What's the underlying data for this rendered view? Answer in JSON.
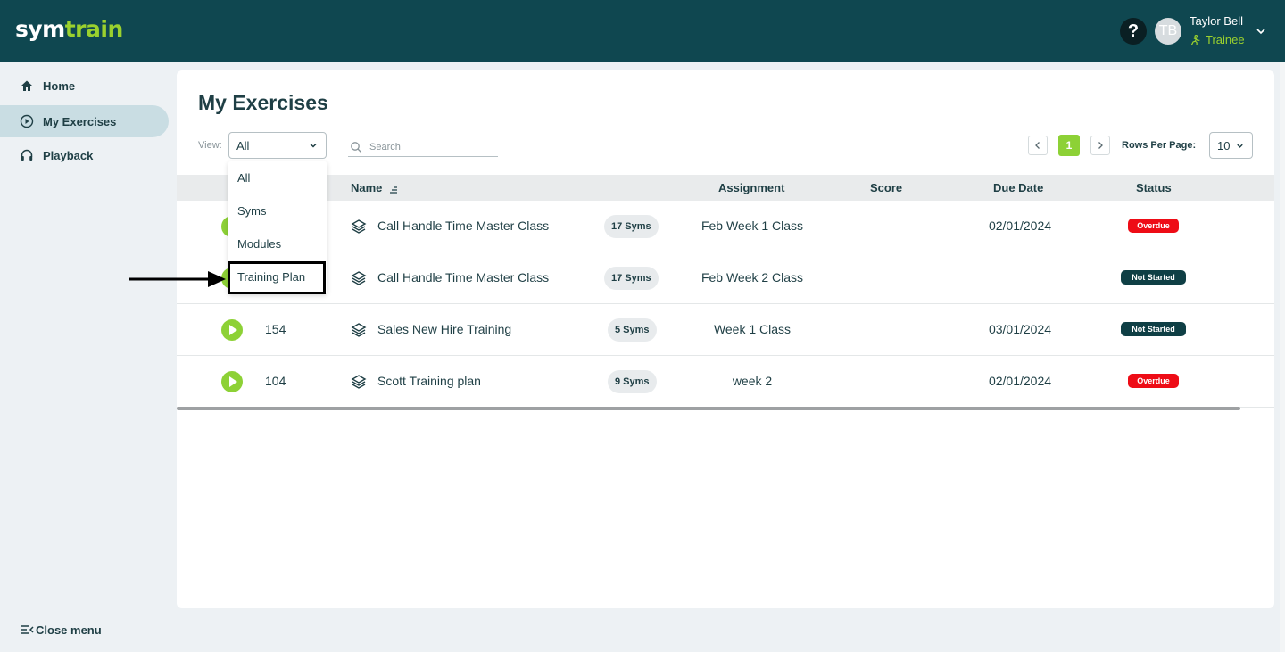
{
  "header": {
    "logo_sym": "sym",
    "logo_train": "train",
    "help": "?",
    "avatar_initials": "TB",
    "user_name": "Taylor Bell",
    "user_role": "Trainee"
  },
  "sidebar": {
    "items": [
      {
        "label": "Home",
        "icon": "home-icon"
      },
      {
        "label": "My Exercises",
        "icon": "play-circle-icon",
        "active": true
      },
      {
        "label": "Playback",
        "icon": "headphones-icon"
      }
    ],
    "close_menu": "Close menu"
  },
  "main": {
    "title": "My Exercises",
    "view_label": "View:",
    "view_value": "All",
    "search_placeholder": "Search",
    "current_page": "1",
    "rows_per_page_label": "Rows Per Page:",
    "rows_per_page_value": "10",
    "columns": [
      "Name",
      "Assignment",
      "Score",
      "Due Date",
      "Status"
    ],
    "rows": [
      {
        "id": "",
        "name": "Call Handle Time Master Class",
        "syms": "17 Syms",
        "assignment": "Feb Week 1 Class",
        "score": "",
        "due": "02/01/2024",
        "status": "Overdue"
      },
      {
        "id": "",
        "name": "Call Handle Time Master Class",
        "syms": "17 Syms",
        "assignment": "Feb Week 2 Class",
        "score": "",
        "due": "",
        "status": "Not Started"
      },
      {
        "id": "154",
        "name": "Sales New Hire Training",
        "syms": "5 Syms",
        "assignment": "Week 1 Class",
        "score": "",
        "due": "03/01/2024",
        "status": "Not Started"
      },
      {
        "id": "104",
        "name": "Scott Training plan",
        "syms": "9 Syms",
        "assignment": "week 2",
        "score": "",
        "due": "02/01/2024",
        "status": "Overdue"
      }
    ]
  },
  "dropdown": {
    "options": [
      "All",
      "Syms",
      "Modules",
      "Training Plan"
    ],
    "highlighted": "Training Plan"
  },
  "colors": {
    "header_bg": "#0f4750",
    "accent_green": "#8dd136",
    "overdue_red": "#ee0c16",
    "not_started": "#0f3f45"
  }
}
